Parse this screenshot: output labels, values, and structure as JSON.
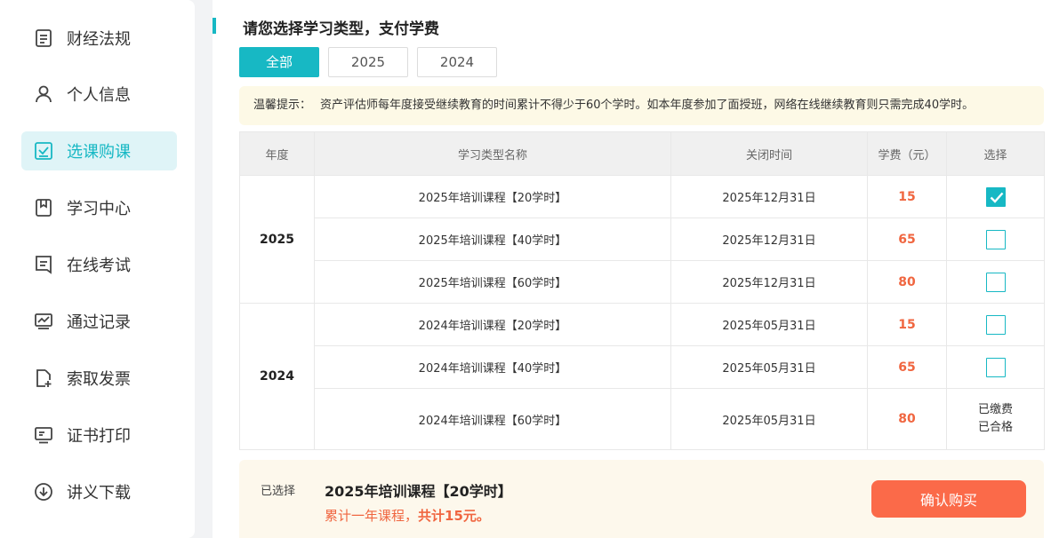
{
  "sidebar": {
    "items": [
      {
        "label": "财经法规",
        "icon": "document-icon",
        "active": false
      },
      {
        "label": "个人信息",
        "icon": "user-icon",
        "active": false
      },
      {
        "label": "选课购课",
        "icon": "checkbox-icon",
        "active": true
      },
      {
        "label": "学习中心",
        "icon": "bookmark-icon",
        "active": false
      },
      {
        "label": "在线考试",
        "icon": "exam-icon",
        "active": false
      },
      {
        "label": "通过记录",
        "icon": "chart-icon",
        "active": false
      },
      {
        "label": "索取发票",
        "icon": "invoice-add-icon",
        "active": false
      },
      {
        "label": "证书打印",
        "icon": "monitor-icon",
        "active": false
      },
      {
        "label": "讲义下载",
        "icon": "download-icon",
        "active": false
      }
    ],
    "accent": "#17b8c4"
  },
  "main": {
    "title": "请您选择学习类型，支付学费",
    "tabs": [
      {
        "label": "全部",
        "active": true
      },
      {
        "label": "2025",
        "active": false
      },
      {
        "label": "2024",
        "active": false
      }
    ],
    "notice": {
      "label": "温馨提示：",
      "text": "资产评估师每年度接受继续教育的时间累计不得少于60个学时。如本年度参加了面授班，网络在线继续教育则只需完成40学时。"
    },
    "table": {
      "headers": [
        "年度",
        "学习类型名称",
        "关闭时间",
        "学费（元）",
        "选择"
      ],
      "groups": [
        {
          "year": "2025",
          "rows": [
            {
              "name": "2025年培训课程【20学时】",
              "close": "2025年12月31日",
              "fee": "15",
              "checked": true
            },
            {
              "name": "2025年培训课程【40学时】",
              "close": "2025年12月31日",
              "fee": "65",
              "checked": false
            },
            {
              "name": "2025年培训课程【60学时】",
              "close": "2025年12月31日",
              "fee": "80",
              "checked": false
            }
          ]
        },
        {
          "year": "2024",
          "rows": [
            {
              "name": "2024年培训课程【20学时】",
              "close": "2025年05月31日",
              "fee": "15",
              "checked": false
            },
            {
              "name": "2024年培训课程【40学时】",
              "close": "2025年05月31日",
              "fee": "65",
              "checked": false
            },
            {
              "name": "2024年培训课程【60学时】",
              "close": "2025年05月31日",
              "fee": "80",
              "status_line1": "已缴费",
              "status_line2": "已合格"
            }
          ]
        }
      ]
    },
    "summary": {
      "label": "已选择",
      "course": "2025年培训课程【20学时】",
      "detail_prefix": "累计一年课程，",
      "detail_total": "共计15元。",
      "buy_label": "确认购买"
    },
    "colors": {
      "fee": "#f06640",
      "buy_button": "#fb6a49",
      "notice_bg": "#fdf9e6"
    }
  }
}
